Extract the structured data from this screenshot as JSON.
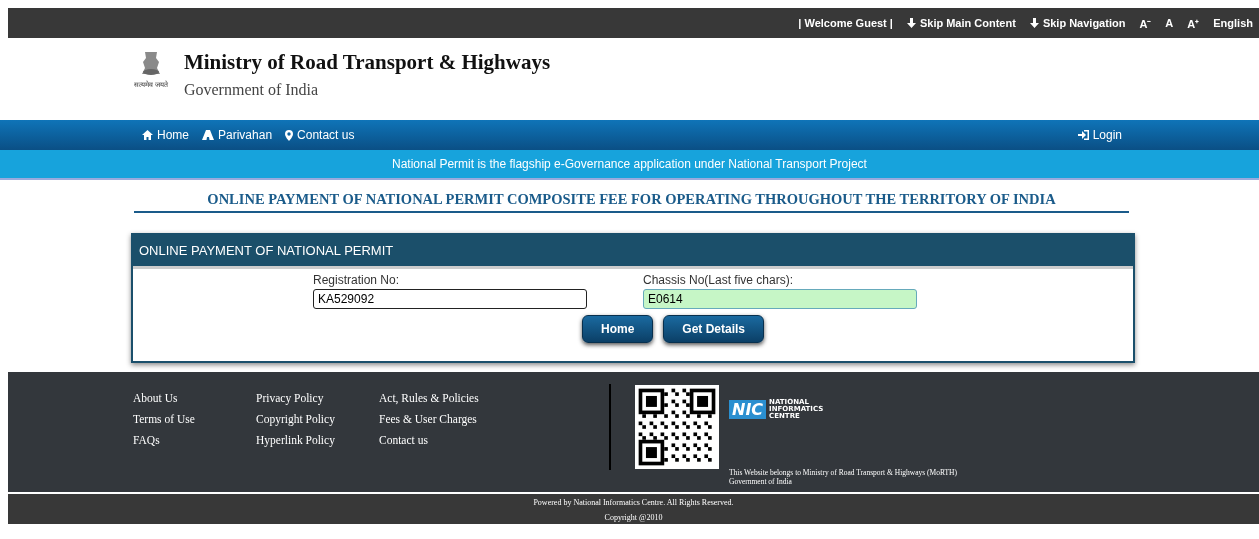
{
  "top_bar": {
    "welcome": "| Welcome Guest |",
    "links": [
      {
        "kind": "skip",
        "label": "Skip Main Content"
      },
      {
        "kind": "skip",
        "label": "Skip Navigation"
      },
      {
        "kind": "font",
        "label": "A⁻"
      },
      {
        "kind": "font",
        "label": "A"
      },
      {
        "kind": "font",
        "label": "A⁺"
      },
      {
        "kind": "lang",
        "label": "English"
      }
    ]
  },
  "header": {
    "emblem_caption": "सत्यमेव जयते",
    "title": "Ministry of Road Transport & Highways",
    "subtitle": "Government of India"
  },
  "nav": {
    "items": [
      {
        "kind": "home",
        "label": "Home"
      },
      {
        "kind": "road",
        "label": "Parivahan"
      },
      {
        "kind": "pin",
        "label": "Contact us"
      }
    ],
    "login": "Login"
  },
  "banner": "National Permit is the flagship e-Governance application under National Transport Project",
  "page_title": "ONLINE PAYMENT OF NATIONAL PERMIT COMPOSITE FEE FOR OPERATING THROUGHOUT THE TERRITORY OF INDIA",
  "panel": {
    "title": "ONLINE PAYMENT OF NATIONAL PERMIT",
    "fields": [
      {
        "label": "Registration No:",
        "value": "KA529092",
        "highlighted": false
      },
      {
        "label": "Chassis No(Last five chars):",
        "value": "E0614",
        "highlighted": true
      }
    ],
    "buttons": [
      "Home",
      "Get Details"
    ]
  },
  "footer": {
    "link_columns": [
      [
        "About Us",
        "Terms of Use",
        "FAQs"
      ],
      [
        "Privacy Policy",
        "Copyright Policy",
        "Hyperlink Policy"
      ],
      [
        "Act, Rules & Policies",
        "Fees & User Charges",
        "Contact us"
      ]
    ],
    "nic_logo": {
      "mark": "NIC",
      "lines": [
        "NATIONAL",
        "INFORMATICS",
        "CENTRE"
      ]
    },
    "ownership": [
      "This Website belongs to Ministry of Road Transport & Highways (MoRTH)",
      "Government of India"
    ]
  },
  "bottom_bar": [
    "Powered by National Informatics Centre. All Rights Reserved.",
    "Copyright @2010"
  ]
}
